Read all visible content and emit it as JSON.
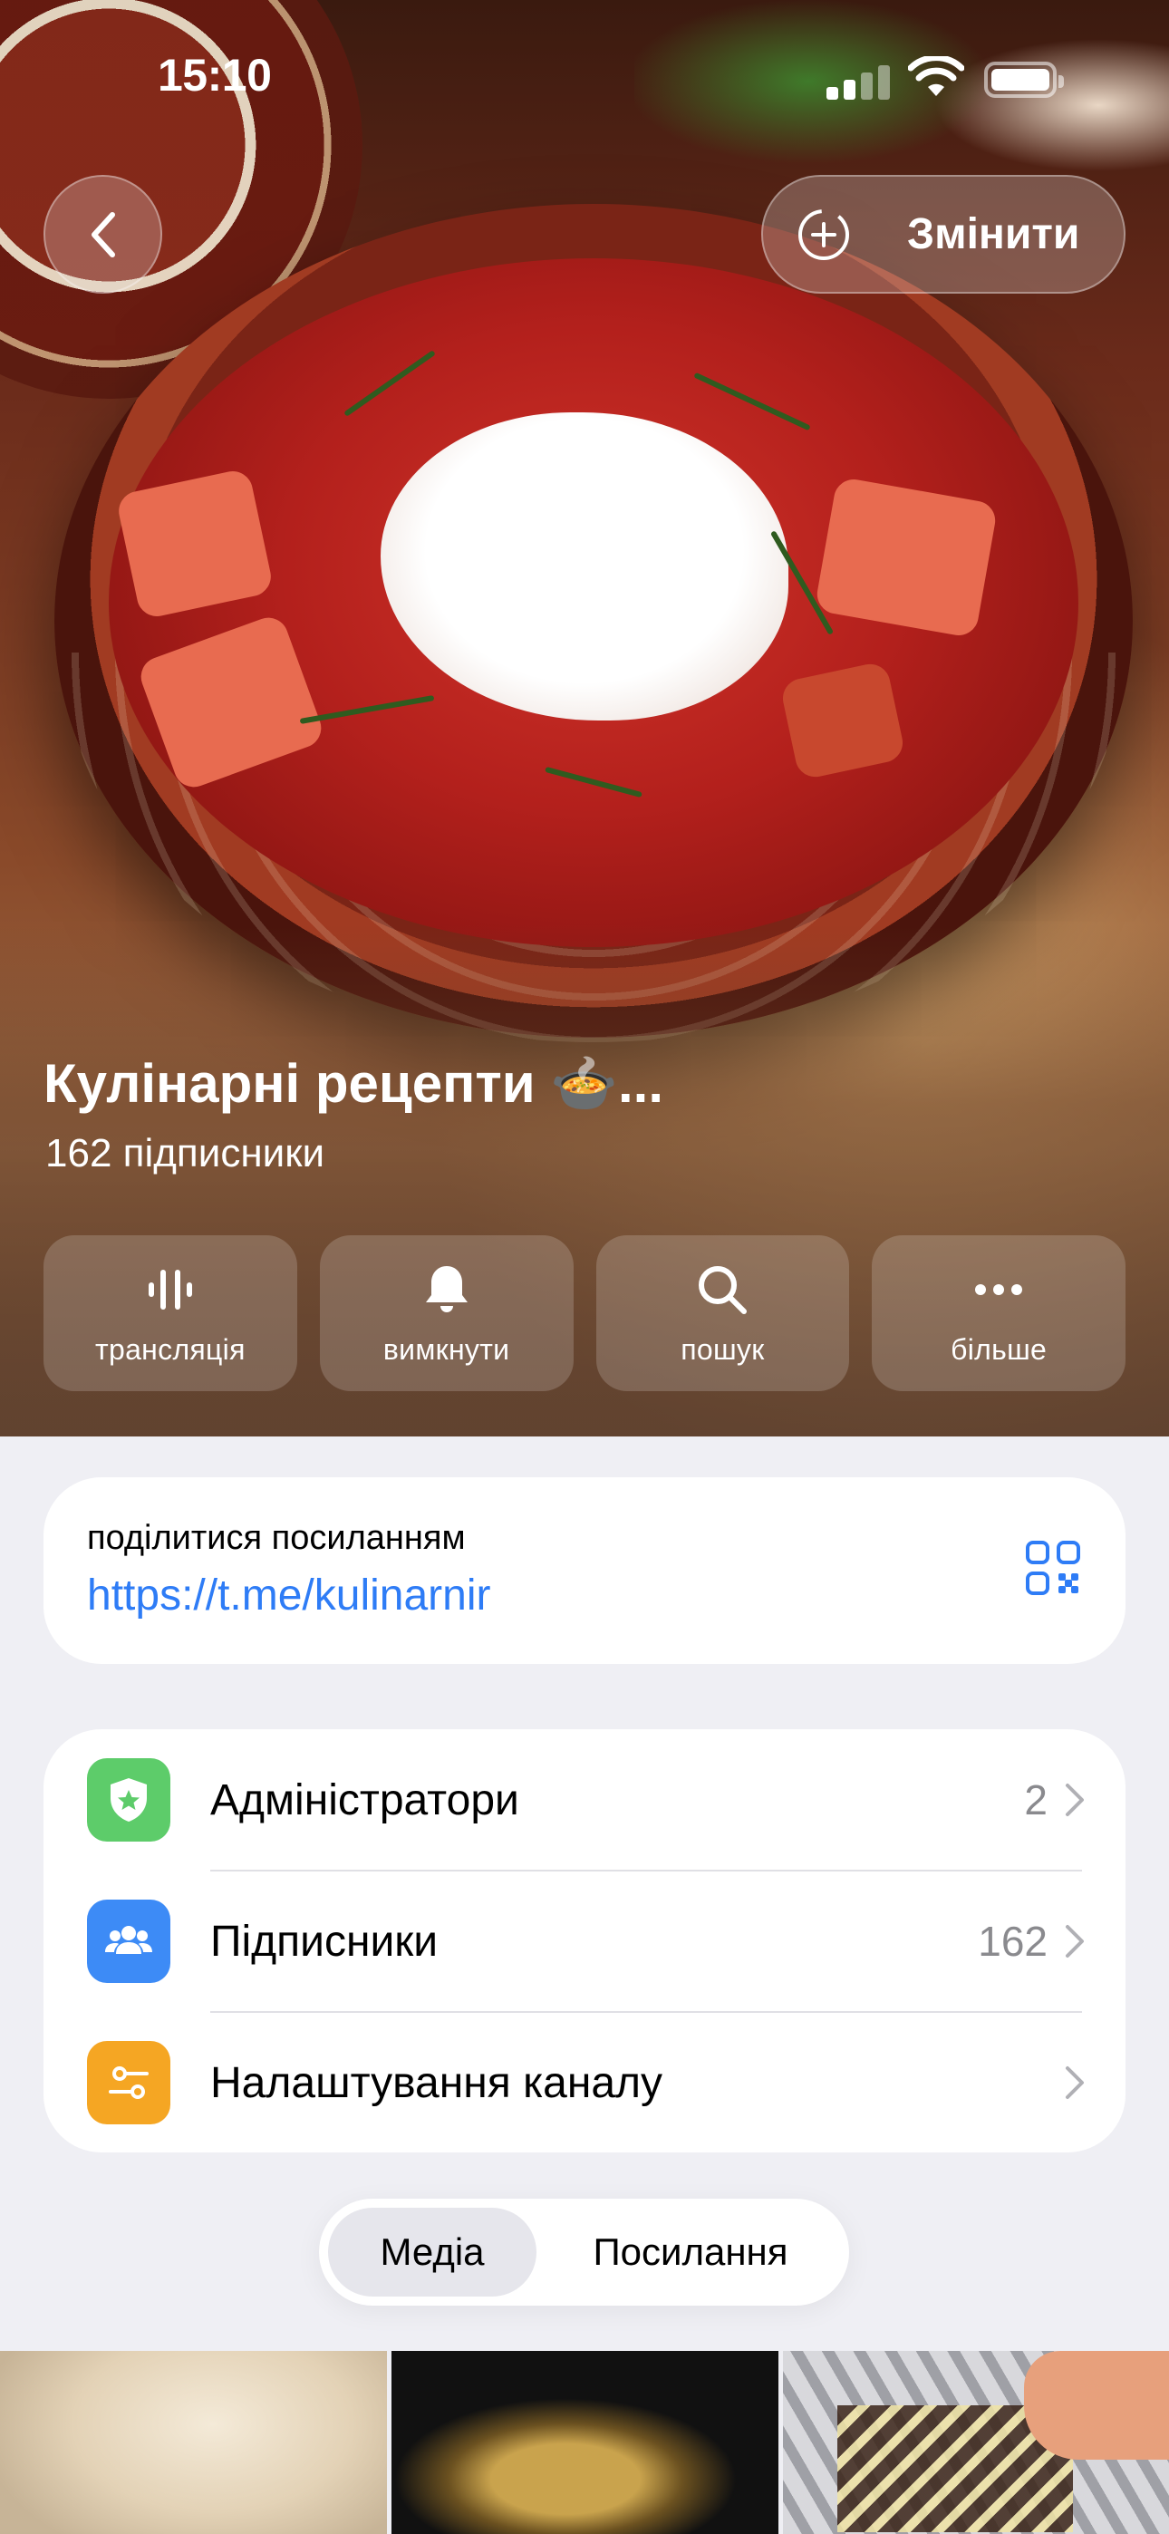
{
  "status_bar": {
    "time": "15:10"
  },
  "nav": {
    "edit_label": "Змінити"
  },
  "channel": {
    "title": "Кулінарні рецепти 🍲...",
    "subscribers_text": "162 підписники"
  },
  "actions": [
    {
      "label": "трансляція",
      "icon": "voice-chat-icon"
    },
    {
      "label": "вимкнути",
      "icon": "bell-icon"
    },
    {
      "label": "пошук",
      "icon": "search-icon"
    },
    {
      "label": "більше",
      "icon": "more-icon"
    }
  ],
  "share": {
    "label": "поділитися посиланням",
    "url": "https://t.me/kulinarnir"
  },
  "list": [
    {
      "title": "Адміністратори",
      "count": "2",
      "icon": "shield-star-icon",
      "color": "#5dcc6a"
    },
    {
      "title": "Підписники",
      "count": "162",
      "icon": "people-icon",
      "color": "#3d8bf6"
    },
    {
      "title": "Налаштування каналу",
      "count": "",
      "icon": "sliders-icon",
      "color": "#f5a623"
    }
  ],
  "tabs": {
    "media": "Медіа",
    "links": "Посилання"
  }
}
